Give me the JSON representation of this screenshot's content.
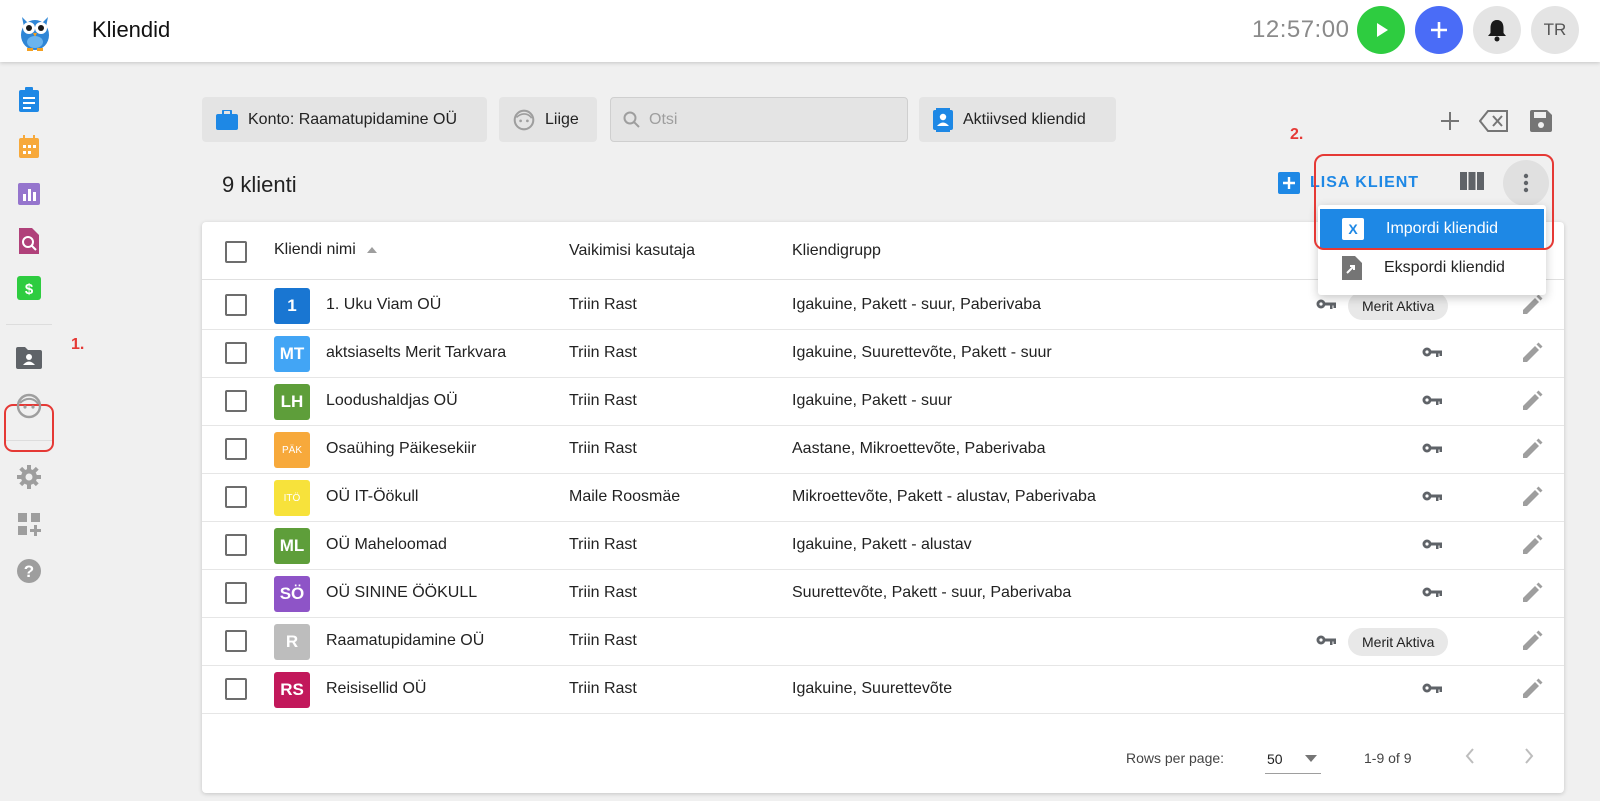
{
  "header": {
    "title": "Kliendid",
    "clock": "12:57:00",
    "avatar_initials": "TR"
  },
  "annotations": {
    "step1": "1.",
    "step2": "2."
  },
  "filters": {
    "account_label": "Konto: Raamatupidamine OÜ",
    "member_label": "Liige",
    "search_placeholder": "Otsi",
    "status_label": "Aktiivsed kliendid"
  },
  "summary": {
    "count_label": "9 klienti",
    "add_client_label": "LISA KLIENT"
  },
  "menu": {
    "items": [
      {
        "label": "Impordi kliendid",
        "icon": "excel-icon",
        "active": true
      },
      {
        "label": "Ekspordi kliendid",
        "icon": "file-export-icon",
        "active": false
      }
    ]
  },
  "table": {
    "headers": {
      "name": "Kliendi nimi",
      "default_user": "Vaikimisi kasutaja",
      "group": "Kliendigrupp"
    },
    "rows": [
      {
        "initials": "1",
        "color": "#1976d2",
        "name": "1. Uku Viam OÜ",
        "user": "Triin Rast",
        "group": "Igakuine, Pakett - suur, Paberivaba",
        "badge": "Merit Aktiva"
      },
      {
        "initials": "MT",
        "color": "#42a5f5",
        "name": "aktsiaselts Merit Tarkvara",
        "user": "Triin Rast",
        "group": "Igakuine, Suurettevõte, Pakett - suur",
        "badge": ""
      },
      {
        "initials": "LH",
        "color": "#5e9e3a",
        "name": "Loodushaldjas OÜ",
        "user": "Triin Rast",
        "group": "Igakuine, Pakett - suur",
        "badge": ""
      },
      {
        "initials": "PÄK",
        "color": "#f7a93b",
        "name": "Osaühing Päikesekiir",
        "user": "Triin Rast",
        "group": "Aastane, Mikroettevõte, Paberivaba",
        "badge": ""
      },
      {
        "initials": "ITÖ",
        "color": "#f7e23b",
        "name": "OÜ IT-Öökull",
        "user": "Maile Roosmäe",
        "group": "Mikroettevõte, Pakett - alustav, Paberivaba",
        "badge": ""
      },
      {
        "initials": "ML",
        "color": "#5e9e3a",
        "name": "OÜ Maheloomad",
        "user": "Triin Rast",
        "group": "Igakuine, Pakett - alustav",
        "badge": ""
      },
      {
        "initials": "SÖ",
        "color": "#8e54c7",
        "name": "OÜ SININE ÖÖKULL",
        "user": "Triin Rast",
        "group": "Suurettevõte, Pakett - suur, Paberivaba",
        "badge": ""
      },
      {
        "initials": "R",
        "color": "#bdbdbd",
        "name": "Raamatupidamine OÜ",
        "user": "Triin Rast",
        "group": "",
        "badge": "Merit Aktiva"
      },
      {
        "initials": "RS",
        "color": "#c2185b",
        "name": "Reisisellid OÜ",
        "user": "Triin Rast",
        "group": "Igakuine, Suurettevõte",
        "badge": ""
      }
    ]
  },
  "pagination": {
    "rows_per_page_label": "Rows per page:",
    "rows_per_page": "50",
    "range": "1-9 of 9"
  }
}
